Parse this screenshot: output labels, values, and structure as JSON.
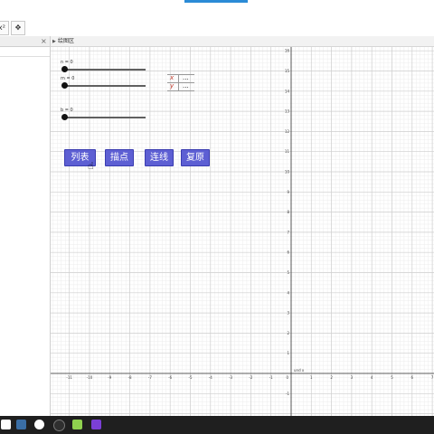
{
  "app": {
    "graphics_view_title": "绘图区"
  },
  "toolbar": {
    "icons": [
      "function-tool-icon",
      "move-graphics-icon"
    ],
    "accent_color": "#2b8bd6"
  },
  "sliders": [
    {
      "label": "n = 0",
      "value": 0
    },
    {
      "label": "m = 0",
      "value": 0
    },
    {
      "label": "b = 0",
      "value": 0
    }
  ],
  "value_table": {
    "rows": [
      {
        "var": "x",
        "value": "..."
      },
      {
        "var": "y",
        "value": "..."
      }
    ]
  },
  "buttons": {
    "list_label": "列表",
    "plot_label": "描点",
    "connect_label": "连线",
    "reset_label": "复原",
    "color": "#5d5fd3"
  },
  "axes": {
    "x_ticks": [
      -11,
      -10,
      -9,
      -8,
      -7,
      -6,
      -5,
      -4,
      -3,
      -2,
      -1,
      1,
      2,
      3,
      4,
      5,
      6,
      7
    ],
    "y_ticks": [
      1,
      2,
      3,
      4,
      5,
      6,
      7,
      8,
      9,
      10,
      11,
      12,
      13,
      14,
      15,
      16,
      -1
    ],
    "origin_label": "0",
    "x_axis_label": "und x",
    "grid": true
  },
  "taskbar": {
    "icons": [
      "start-icon",
      "file-explorer-icon",
      "chrome-icon",
      "app-icon",
      "geogebra-icon",
      "media-icon"
    ]
  }
}
